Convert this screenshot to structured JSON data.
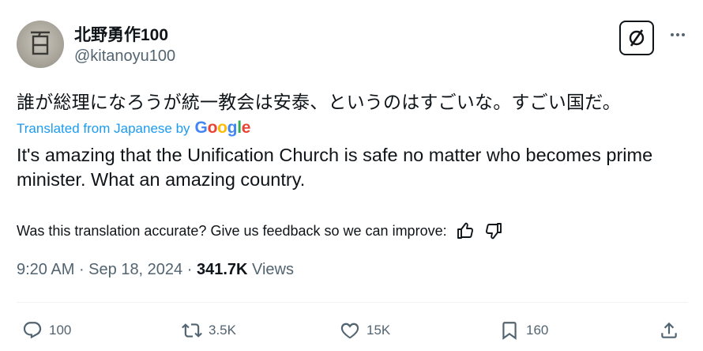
{
  "tweet": {
    "author": {
      "name": "北野勇作100",
      "handle": "@kitanoyu100",
      "avatar_glyph": "百"
    },
    "text": "誰が総理になろうが統一教会は安泰、というのはすごいな。すごい国だ。",
    "translation": {
      "label": "Translated from Japanese by",
      "provider": "Google",
      "text": "It's amazing that the Unification Church is safe no matter who becomes prime minister. What an amazing country."
    },
    "feedback": {
      "prompt": "Was this translation accurate? Give us feedback so we can improve:"
    },
    "meta": {
      "time": "9:20 AM",
      "separator": " · ",
      "date": "Sep 18, 2024",
      "views_count": "341.7K",
      "views_label": " Views"
    },
    "actions": {
      "replies": "100",
      "reposts": "3.5K",
      "likes": "15K",
      "bookmarks": "160"
    }
  },
  "icons": {
    "grok": "grok-icon",
    "more": "more-icon",
    "thumbs_up": "thumbs-up-icon",
    "thumbs_down": "thumbs-down-icon",
    "reply": "reply-icon",
    "repost": "repost-icon",
    "like": "heart-icon",
    "bookmark": "bookmark-icon",
    "share": "share-icon"
  },
  "colors": {
    "link": "#1d9bf0",
    "muted": "#536471",
    "text": "#0f1419"
  }
}
